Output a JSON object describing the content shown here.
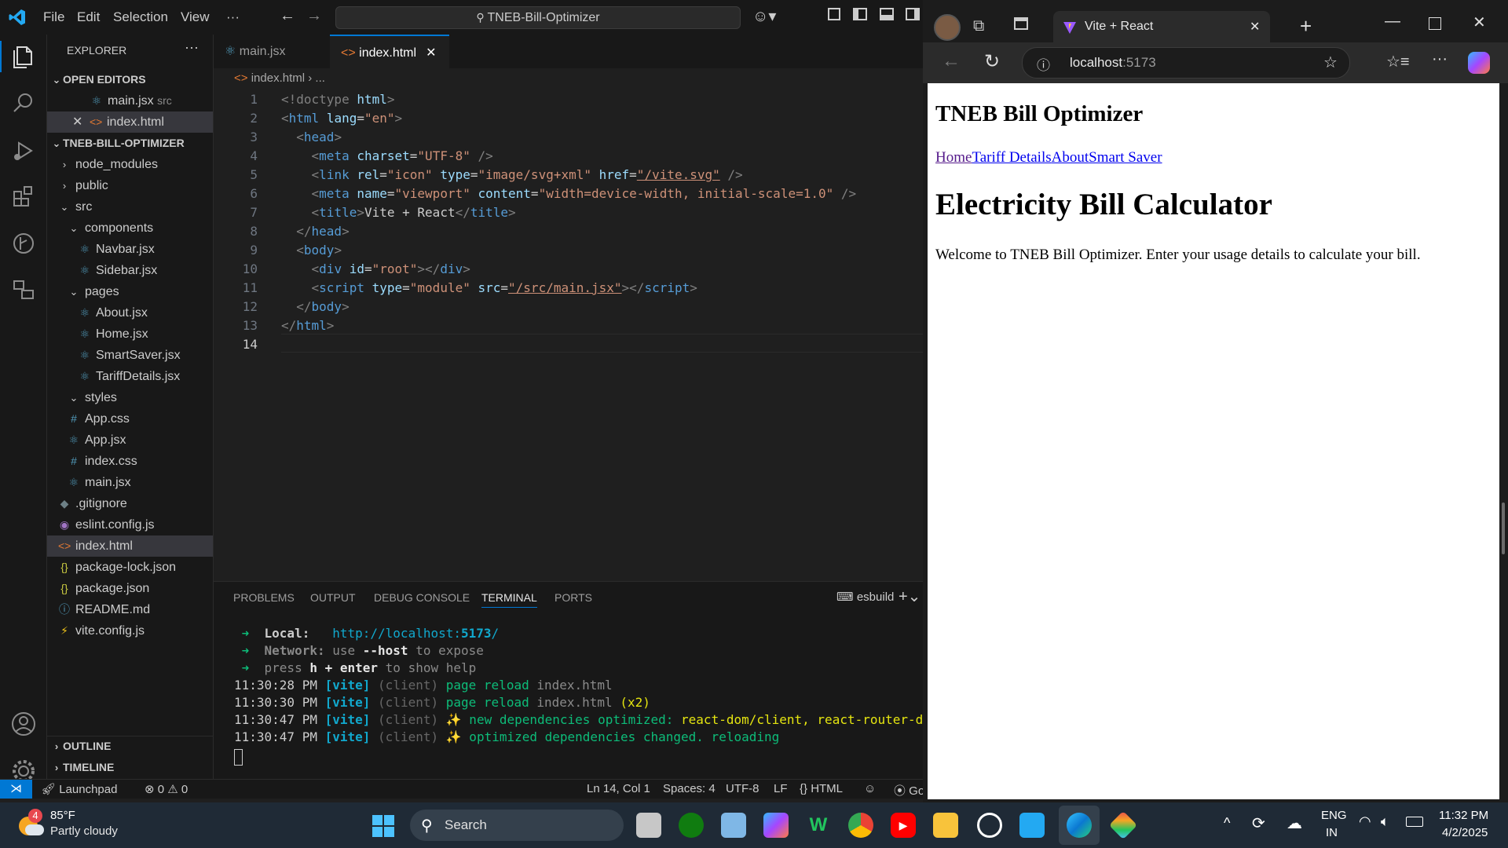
{
  "vscode": {
    "menu": [
      "File",
      "Edit",
      "Selection",
      "View",
      "···"
    ],
    "command_center": "TNEB-Bill-Optimizer",
    "explorer_title": "EXPLORER",
    "open_editors_title": "OPEN EDITORS",
    "open_editors": [
      {
        "name": "main.jsx",
        "hint": "src"
      },
      {
        "name": "index.html",
        "hint": ""
      }
    ],
    "project_title": "TNEB-BILL-OPTIMIZER",
    "tree": [
      {
        "name": "node_modules"
      },
      {
        "name": "public"
      },
      {
        "name": "src"
      },
      {
        "name": "components"
      },
      {
        "name": "Navbar.jsx"
      },
      {
        "name": "Sidebar.jsx"
      },
      {
        "name": "pages"
      },
      {
        "name": "About.jsx"
      },
      {
        "name": "Home.jsx"
      },
      {
        "name": "SmartSaver.jsx"
      },
      {
        "name": "TariffDetails.jsx"
      },
      {
        "name": "styles"
      },
      {
        "name": "App.css"
      },
      {
        "name": "App.jsx"
      },
      {
        "name": "index.css"
      },
      {
        "name": "main.jsx"
      },
      {
        "name": ".gitignore"
      },
      {
        "name": "eslint.config.js"
      },
      {
        "name": "index.html"
      },
      {
        "name": "package-lock.json"
      },
      {
        "name": "package.json"
      },
      {
        "name": "README.md"
      },
      {
        "name": "vite.config.js"
      }
    ],
    "outline_title": "OUTLINE",
    "timeline_title": "TIMELINE",
    "tabs": [
      {
        "label": "main.jsx"
      },
      {
        "label": "index.html"
      }
    ],
    "breadcrumb": [
      "index.html",
      "..."
    ],
    "line_numbers": [
      "1",
      "2",
      "3",
      "4",
      "5",
      "6",
      "7",
      "8",
      "9",
      "10",
      "11",
      "12",
      "13",
      "14"
    ],
    "code": {
      "l1a": "<!doctype ",
      "l1b": "html",
      "l1c": ">",
      "l2a": "<",
      "l2b": "html ",
      "l2c": "lang",
      "l2d": "=",
      "l2e": "\"en\"",
      "l2f": ">",
      "l3a": "  <",
      "l3b": "head",
      "l3c": ">",
      "l4a": "    <",
      "l4b": "meta ",
      "l4c": "charset",
      "l4d": "=",
      "l4e": "\"UTF-8\"",
      "l4f": " />",
      "l5a": "    <",
      "l5b": "link ",
      "l5c": "rel",
      "l5d": "=",
      "l5e": "\"icon\" ",
      "l5f": "type",
      "l5g": "=",
      "l5h": "\"image/svg+xml\" ",
      "l5i": "href",
      "l5j": "=",
      "l5k": "\"/vite.svg\"",
      "l5l": " />",
      "l6a": "    <",
      "l6b": "meta ",
      "l6c": "name",
      "l6d": "=",
      "l6e": "\"viewport\" ",
      "l6f": "content",
      "l6g": "=",
      "l6h": "\"width=device-width, initial-scale=1.0\"",
      "l6i": " />",
      "l7a": "    <",
      "l7b": "title",
      "l7c": ">",
      "l7d": "Vite + React",
      "l7e": "</",
      "l7f": "title",
      "l7g": ">",
      "l8a": "  </",
      "l8b": "head",
      "l8c": ">",
      "l9a": "  <",
      "l9b": "body",
      "l9c": ">",
      "l10a": "    <",
      "l10b": "div ",
      "l10c": "id",
      "l10d": "=",
      "l10e": "\"root\"",
      "l10f": "></",
      "l10g": "div",
      "l10h": ">",
      "l11a": "    <",
      "l11b": "script ",
      "l11c": "type",
      "l11d": "=",
      "l11e": "\"module\" ",
      "l11f": "src",
      "l11g": "=",
      "l11h": "\"/src/main.jsx\"",
      "l11i": "></",
      "l11j": "script",
      "l11k": ">",
      "l12a": "  </",
      "l12b": "body",
      "l12c": ">",
      "l13a": "</",
      "l13b": "html",
      "l13c": ">"
    },
    "panel_tabs": [
      "PROBLEMS",
      "OUTPUT",
      "DEBUG CONSOLE",
      "TERMINAL",
      "PORTS"
    ],
    "terminal_name": "esbuild",
    "terminal": {
      "local_label": "Local:",
      "local_url": "http://localhost:",
      "local_port": "5173",
      "local_end": "/",
      "network_label": "Network:",
      "network_a": " use ",
      "network_b": "--host",
      "network_c": " to expose",
      "press_a": "press ",
      "press_b": "h + enter",
      "press_c": " to show help",
      "lines": [
        {
          "time": "11:30:28 PM",
          "tag": "[vite]",
          "scope": "(client)",
          "msg": "page reload",
          "file": "index.html",
          "extra": ""
        },
        {
          "time": "11:30:30 PM",
          "tag": "[vite]",
          "scope": "(client)",
          "msg": "page reload",
          "file": "index.html",
          "extra": "(x2)"
        },
        {
          "time": "11:30:47 PM",
          "tag": "[vite]",
          "scope": "(client)",
          "msg": "✨ new dependencies optimized: ",
          "file": "react-dom/client, react-router-dom",
          "extra": ""
        },
        {
          "time": "11:30:47 PM",
          "tag": "[vite]",
          "scope": "(client)",
          "msg": "✨ optimized dependencies changed. reloading",
          "file": "",
          "extra": ""
        }
      ]
    },
    "status": {
      "launchpad": "Launchpad",
      "errors": "0",
      "warnings": "0",
      "position": "Ln 14, Col 1",
      "spaces": "Spaces: 4",
      "encoding": "UTF-8",
      "eol": "LF",
      "language": "HTML",
      "go": "Go"
    }
  },
  "browser": {
    "tab_title": "Vite + React",
    "url_host": "localhost",
    "url_port": ":5173",
    "page": {
      "site_title": "TNEB Bill Optimizer",
      "nav": [
        "Home",
        "Tariff Details",
        "About",
        "Smart Saver"
      ],
      "heading": "Electricity Bill Calculator",
      "paragraph": "Welcome to TNEB Bill Optimizer. Enter your usage details to calculate your bill."
    }
  },
  "taskbar": {
    "weather_temp": "85°F",
    "weather_desc": "Partly cloudy",
    "weather_badge": "4",
    "search": "Search",
    "lang1": "ENG",
    "lang2": "IN",
    "time": "11:32 PM",
    "date": "4/2/2025"
  }
}
